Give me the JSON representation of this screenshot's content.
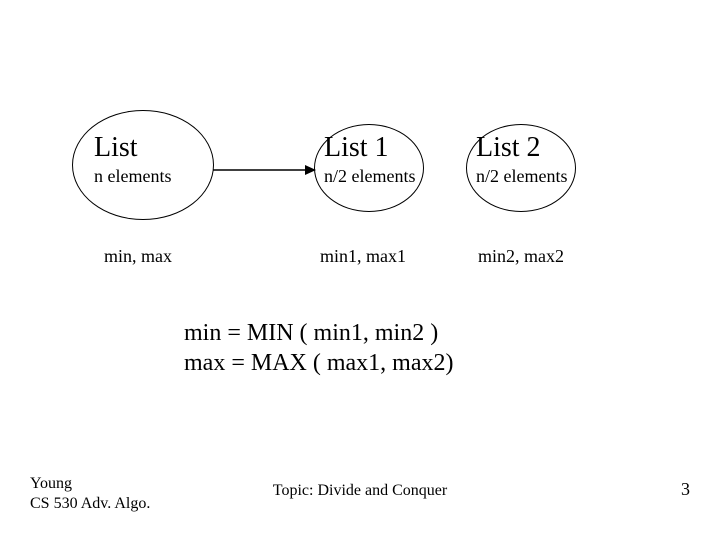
{
  "nodes": {
    "list": {
      "title": "List",
      "sub": "n elements"
    },
    "list1": {
      "title": "List 1",
      "sub": "n/2 elements"
    },
    "list2": {
      "title": "List 2",
      "sub": "n/2 elements"
    }
  },
  "below": {
    "list": "min, max",
    "list1": "min1, max1",
    "list2": "min2, max2"
  },
  "equations": {
    "line1": "min  =  MIN ( min1, min2 )",
    "line2": "max  =  MAX ( max1, max2)"
  },
  "footer": {
    "author1": "Young",
    "author2": "CS 530 Adv. Algo.",
    "topic": "Topic: Divide and Conquer",
    "page": "3"
  }
}
